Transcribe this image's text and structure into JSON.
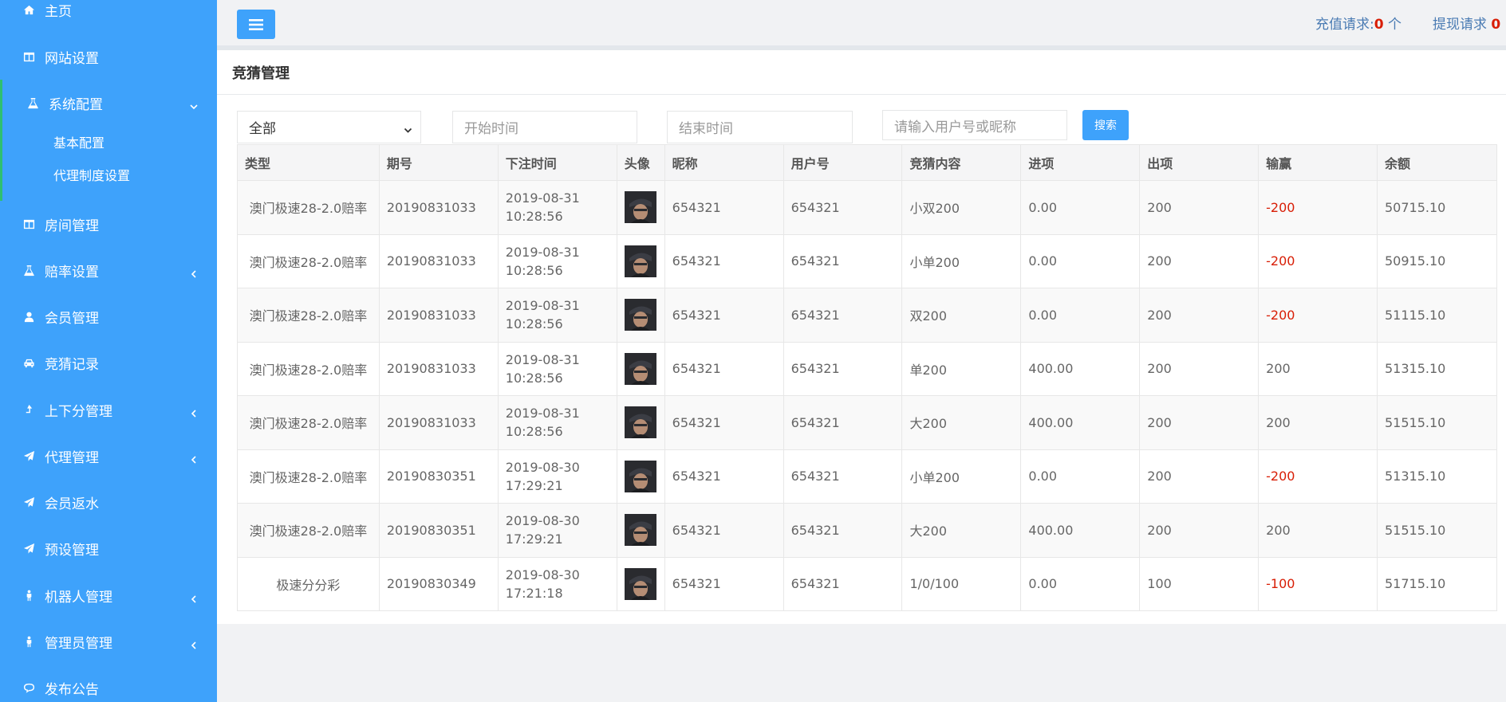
{
  "sidebar": {
    "items": [
      {
        "label": "主页",
        "icon": "home-icon"
      },
      {
        "label": "网站设置",
        "icon": "columns-icon"
      },
      {
        "label": "系统配置",
        "icon": "flask-icon"
      },
      {
        "label": "房间管理",
        "icon": "columns-icon"
      },
      {
        "label": "赔率设置",
        "icon": "flask-icon"
      },
      {
        "label": "会员管理",
        "icon": "user-icon"
      },
      {
        "label": "竞猜记录",
        "icon": "car-icon"
      },
      {
        "label": "上下分管理",
        "icon": "level-up-icon"
      },
      {
        "label": "代理管理",
        "icon": "paper-plane-icon"
      },
      {
        "label": "会员返水",
        "icon": "paper-plane-icon"
      },
      {
        "label": "预设管理",
        "icon": "paper-plane-icon"
      },
      {
        "label": "机器人管理",
        "icon": "male-icon"
      },
      {
        "label": "管理员管理",
        "icon": "male-icon"
      },
      {
        "label": "发布公告",
        "icon": "comment-icon"
      }
    ],
    "sub_items": [
      "基本配置",
      "代理制度设置"
    ]
  },
  "topbar": {
    "recharge_label": "充值请求:",
    "recharge_count": "0",
    "recharge_unit": " 个",
    "withdraw_label": "提现请求 ",
    "withdraw_count": "0"
  },
  "panel": {
    "title": "竞猜管理"
  },
  "filters": {
    "type_selected": "全部",
    "start_placeholder": "开始时间",
    "end_placeholder": "结束时间",
    "search_placeholder": "请输入用户号或昵称",
    "search_button": "搜索"
  },
  "table": {
    "headers": [
      "类型",
      "期号",
      "下注时间",
      "头像",
      "昵称",
      "用户号",
      "竞猜内容",
      "进项",
      "出项",
      "输赢",
      "余额"
    ],
    "rows": [
      {
        "type": "澳门极速28-2.0赔率",
        "issue": "20190831033",
        "date": "2019-08-31",
        "clock": "10:28:56",
        "nickname": "654321",
        "user_no": "654321",
        "content": "小双200",
        "income": "0.00",
        "outgo": "200",
        "result": "-200",
        "balance": "50715.10"
      },
      {
        "type": "澳门极速28-2.0赔率",
        "issue": "20190831033",
        "date": "2019-08-31",
        "clock": "10:28:56",
        "nickname": "654321",
        "user_no": "654321",
        "content": "小单200",
        "income": "0.00",
        "outgo": "200",
        "result": "-200",
        "balance": "50915.10"
      },
      {
        "type": "澳门极速28-2.0赔率",
        "issue": "20190831033",
        "date": "2019-08-31",
        "clock": "10:28:56",
        "nickname": "654321",
        "user_no": "654321",
        "content": "双200",
        "income": "0.00",
        "outgo": "200",
        "result": "-200",
        "balance": "51115.10"
      },
      {
        "type": "澳门极速28-2.0赔率",
        "issue": "20190831033",
        "date": "2019-08-31",
        "clock": "10:28:56",
        "nickname": "654321",
        "user_no": "654321",
        "content": "单200",
        "income": "400.00",
        "outgo": "200",
        "result": "200",
        "balance": "51315.10"
      },
      {
        "type": "澳门极速28-2.0赔率",
        "issue": "20190831033",
        "date": "2019-08-31",
        "clock": "10:28:56",
        "nickname": "654321",
        "user_no": "654321",
        "content": "大200",
        "income": "400.00",
        "outgo": "200",
        "result": "200",
        "balance": "51515.10"
      },
      {
        "type": "澳门极速28-2.0赔率",
        "issue": "20190830351",
        "date": "2019-08-30",
        "clock": "17:29:21",
        "nickname": "654321",
        "user_no": "654321",
        "content": "小单200",
        "income": "0.00",
        "outgo": "200",
        "result": "-200",
        "balance": "51315.10"
      },
      {
        "type": "澳门极速28-2.0赔率",
        "issue": "20190830351",
        "date": "2019-08-30",
        "clock": "17:29:21",
        "nickname": "654321",
        "user_no": "654321",
        "content": "大200",
        "income": "400.00",
        "outgo": "200",
        "result": "200",
        "balance": "51515.10"
      },
      {
        "type": "极速分分彩",
        "issue": "20190830349",
        "date": "2019-08-30",
        "clock": "17:21:18",
        "nickname": "654321",
        "user_no": "654321",
        "content": "1/0/100",
        "income": "0.00",
        "outgo": "100",
        "result": "-100",
        "balance": "51715.10"
      }
    ]
  },
  "colors": {
    "sidebar_bg": "#3ea2fb",
    "accent": "#3ea2fb",
    "negative": "#d81e06",
    "active_marker": "#2fbf71"
  }
}
